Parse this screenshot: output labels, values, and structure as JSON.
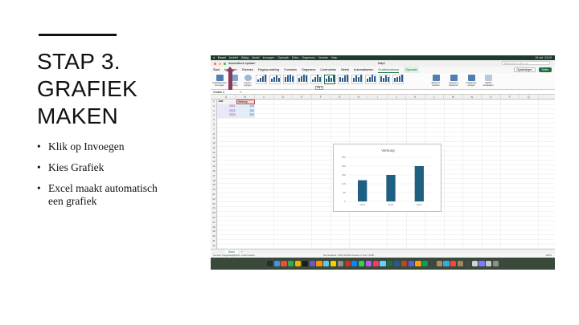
{
  "slide": {
    "title_lines": [
      "STAP 3.",
      "GRAFIEK",
      "MAKEN"
    ],
    "bullets": [
      "Klik op Invoegen",
      "Kies Grafiek",
      "Excel maakt automatisch een grafiek"
    ]
  },
  "screenshot": {
    "menubar": {
      "items": [
        "Excel",
        "Archief",
        "Wijzig",
        "Beeld",
        "Invoegen",
        "Opmaak",
        "Extra",
        "Gegevens",
        "Venster",
        "Help"
      ],
      "clock": "15 okt. 13:19"
    },
    "titlebar": {
      "autosave": "Automatisch opslaan",
      "document": "Map1",
      "search_placeholder": "Zoek (Cmd + Ctrl + U)"
    },
    "ribbon_tabs": [
      "Start",
      "Invoegen",
      "Tekenen",
      "Pagina-indeling",
      "Formules",
      "Gegevens",
      "Controleren",
      "Beeld",
      "Automatiseren",
      "Grafiekontwerp",
      "Opmaak"
    ],
    "active_tab": "Grafiekontwerp",
    "ribbon_right": {
      "comments": "Opmerkingen",
      "share": "Delen"
    },
    "ribbon_buttons": {
      "add_element": "Grafiekelement toevoegen",
      "quick_layout": "Snelle indeling",
      "change_colors": "Kleuren wijzigen",
      "switch_rowcol": "Rij/kolom wisselen",
      "select_data": "Gegevens selecteren",
      "change_type": "Grafiektype wijzigen",
      "move_chart": "Grafiek verplaatsen"
    },
    "gallery_tooltip": "Stijl 1",
    "formula_bar": {
      "name_box": "Grafiek 4",
      "fx": "fx"
    },
    "columns": [
      "A",
      "B",
      "C",
      "D",
      "E",
      "F",
      "G",
      "H",
      "I",
      "J",
      "K",
      "L",
      "M",
      "N",
      "O",
      "P",
      "Q"
    ],
    "table": {
      "headers": [
        "Jaar",
        "Verkoop"
      ],
      "rows": [
        {
          "year": "2021",
          "value": "120"
        },
        {
          "year": "2022",
          "value": "150"
        },
        {
          "year": "2023",
          "value": "200"
        }
      ]
    },
    "chart_data": {
      "type": "bar",
      "title": "Verkoop",
      "categories": [
        "2021",
        "2022",
        "2023"
      ],
      "values": [
        120,
        150,
        200
      ],
      "ylim": [
        0,
        250
      ],
      "yticks": [
        0,
        50,
        100,
        150,
        200,
        250
      ],
      "grid": true,
      "bar_color": "#1f5f82"
    },
    "sheet_tab": "Blad1",
    "sheet_add": "+",
    "statusbar": {
      "left": "Gereed   Toegankelijkheid: onderzoeken",
      "middle": "Gemiddelde: 1003,333333   Aantal: 6   Som: 6020",
      "zoom": "100%"
    }
  }
}
